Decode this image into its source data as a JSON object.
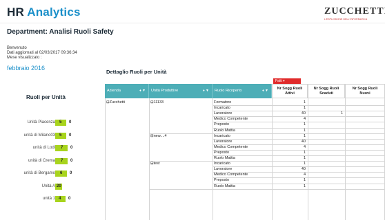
{
  "header": {
    "title_part1": "HR ",
    "title_part2": "Analytics",
    "logo_text": "ZUCCHETTI",
    "logo_sub": "L'ESPLOSIONE DELL'INFORMATICA"
  },
  "department": "Department: Analisi Ruoli Safety",
  "info": {
    "welcome": "Benvenuto",
    "updated": "Dati aggiornati al 02/03/2017 09:36:34",
    "month_label": "Mese visualizzato :",
    "month_value": "febbraio 2016"
  },
  "left_chart": {
    "title": "Ruoli per Unità",
    "rows": [
      {
        "label": "Unità Piacenza",
        "a": "5",
        "b": "0",
        "a_val": 5
      },
      {
        "label": "unità di Milano03",
        "a": "5",
        "b": "0",
        "a_val": 5
      },
      {
        "label": "unità di Lodi",
        "a": "7",
        "b": "0",
        "a_val": 7
      },
      {
        "label": "unità di Crema",
        "a": "7",
        "b": "0",
        "a_val": 7
      },
      {
        "label": "unità di Bergamo",
        "a": "6",
        "b": "0",
        "a_val": 6
      },
      {
        "label": "Unità A",
        "a": "20",
        "b": "",
        "a_val": 20
      },
      {
        "label": "unità 1",
        "a": "4",
        "b": "0",
        "a_val": 4
      }
    ]
  },
  "table": {
    "title": "Dettaglio Ruoli per Unità",
    "filter_tag": "Fatti",
    "dim_headers": [
      "Azienda",
      "Unità Produttive",
      "Ruolo Ricoperto"
    ],
    "measure_headers": [
      {
        "l1": "Nr Sogg Ruoli",
        "l2": "Attivi"
      },
      {
        "l1": "Nr Sogg Ruoli",
        "l2": "Scaduti"
      },
      {
        "l1": "Nr Sogg Ruoli",
        "l2": "Nuovi"
      }
    ],
    "company": "Zucchetti",
    "groups": [
      {
        "unit": "11133",
        "rows": [
          {
            "role": "Formatore",
            "attivi": "1",
            "scaduti": ""
          },
          {
            "role": "Incaricato",
            "attivi": "1",
            "scaduti": ""
          },
          {
            "role": "Lavoratore",
            "attivi": "40",
            "scaduti": "1"
          },
          {
            "role": "Medico Competente",
            "attivi": "4",
            "scaduti": ""
          },
          {
            "role": "Preposto",
            "attivi": "1",
            "scaduti": ""
          },
          {
            "role": "Ruolo Mattia",
            "attivi": "1",
            "scaduti": ""
          }
        ]
      },
      {
        "unit": "new....4",
        "rows": [
          {
            "role": "Incaricato",
            "attivi": "1",
            "scaduti": ""
          },
          {
            "role": "Lavoratore",
            "attivi": "40",
            "scaduti": ""
          },
          {
            "role": "Medico Competente",
            "attivi": "4",
            "scaduti": ""
          },
          {
            "role": "Preposto",
            "attivi": "1",
            "scaduti": ""
          },
          {
            "role": "Ruolo Mattia",
            "attivi": "1",
            "scaduti": ""
          }
        ]
      },
      {
        "unit": "test",
        "rows": [
          {
            "role": "Incaricato",
            "attivi": "1",
            "scaduti": ""
          },
          {
            "role": "Lavoratore",
            "attivi": "40",
            "scaduti": ""
          },
          {
            "role": "Medico Competente",
            "attivi": "4",
            "scaduti": ""
          },
          {
            "role": "Preposto",
            "attivi": "1",
            "scaduti": ""
          },
          {
            "role": "Ruolo Mattia",
            "attivi": "1",
            "scaduti": ""
          }
        ]
      }
    ]
  },
  "colors": {
    "accent": "#1a8fc9",
    "header_teal": "#4daeb7",
    "bar_green": "#a8d41d",
    "filter_red": "#e02b2b"
  }
}
